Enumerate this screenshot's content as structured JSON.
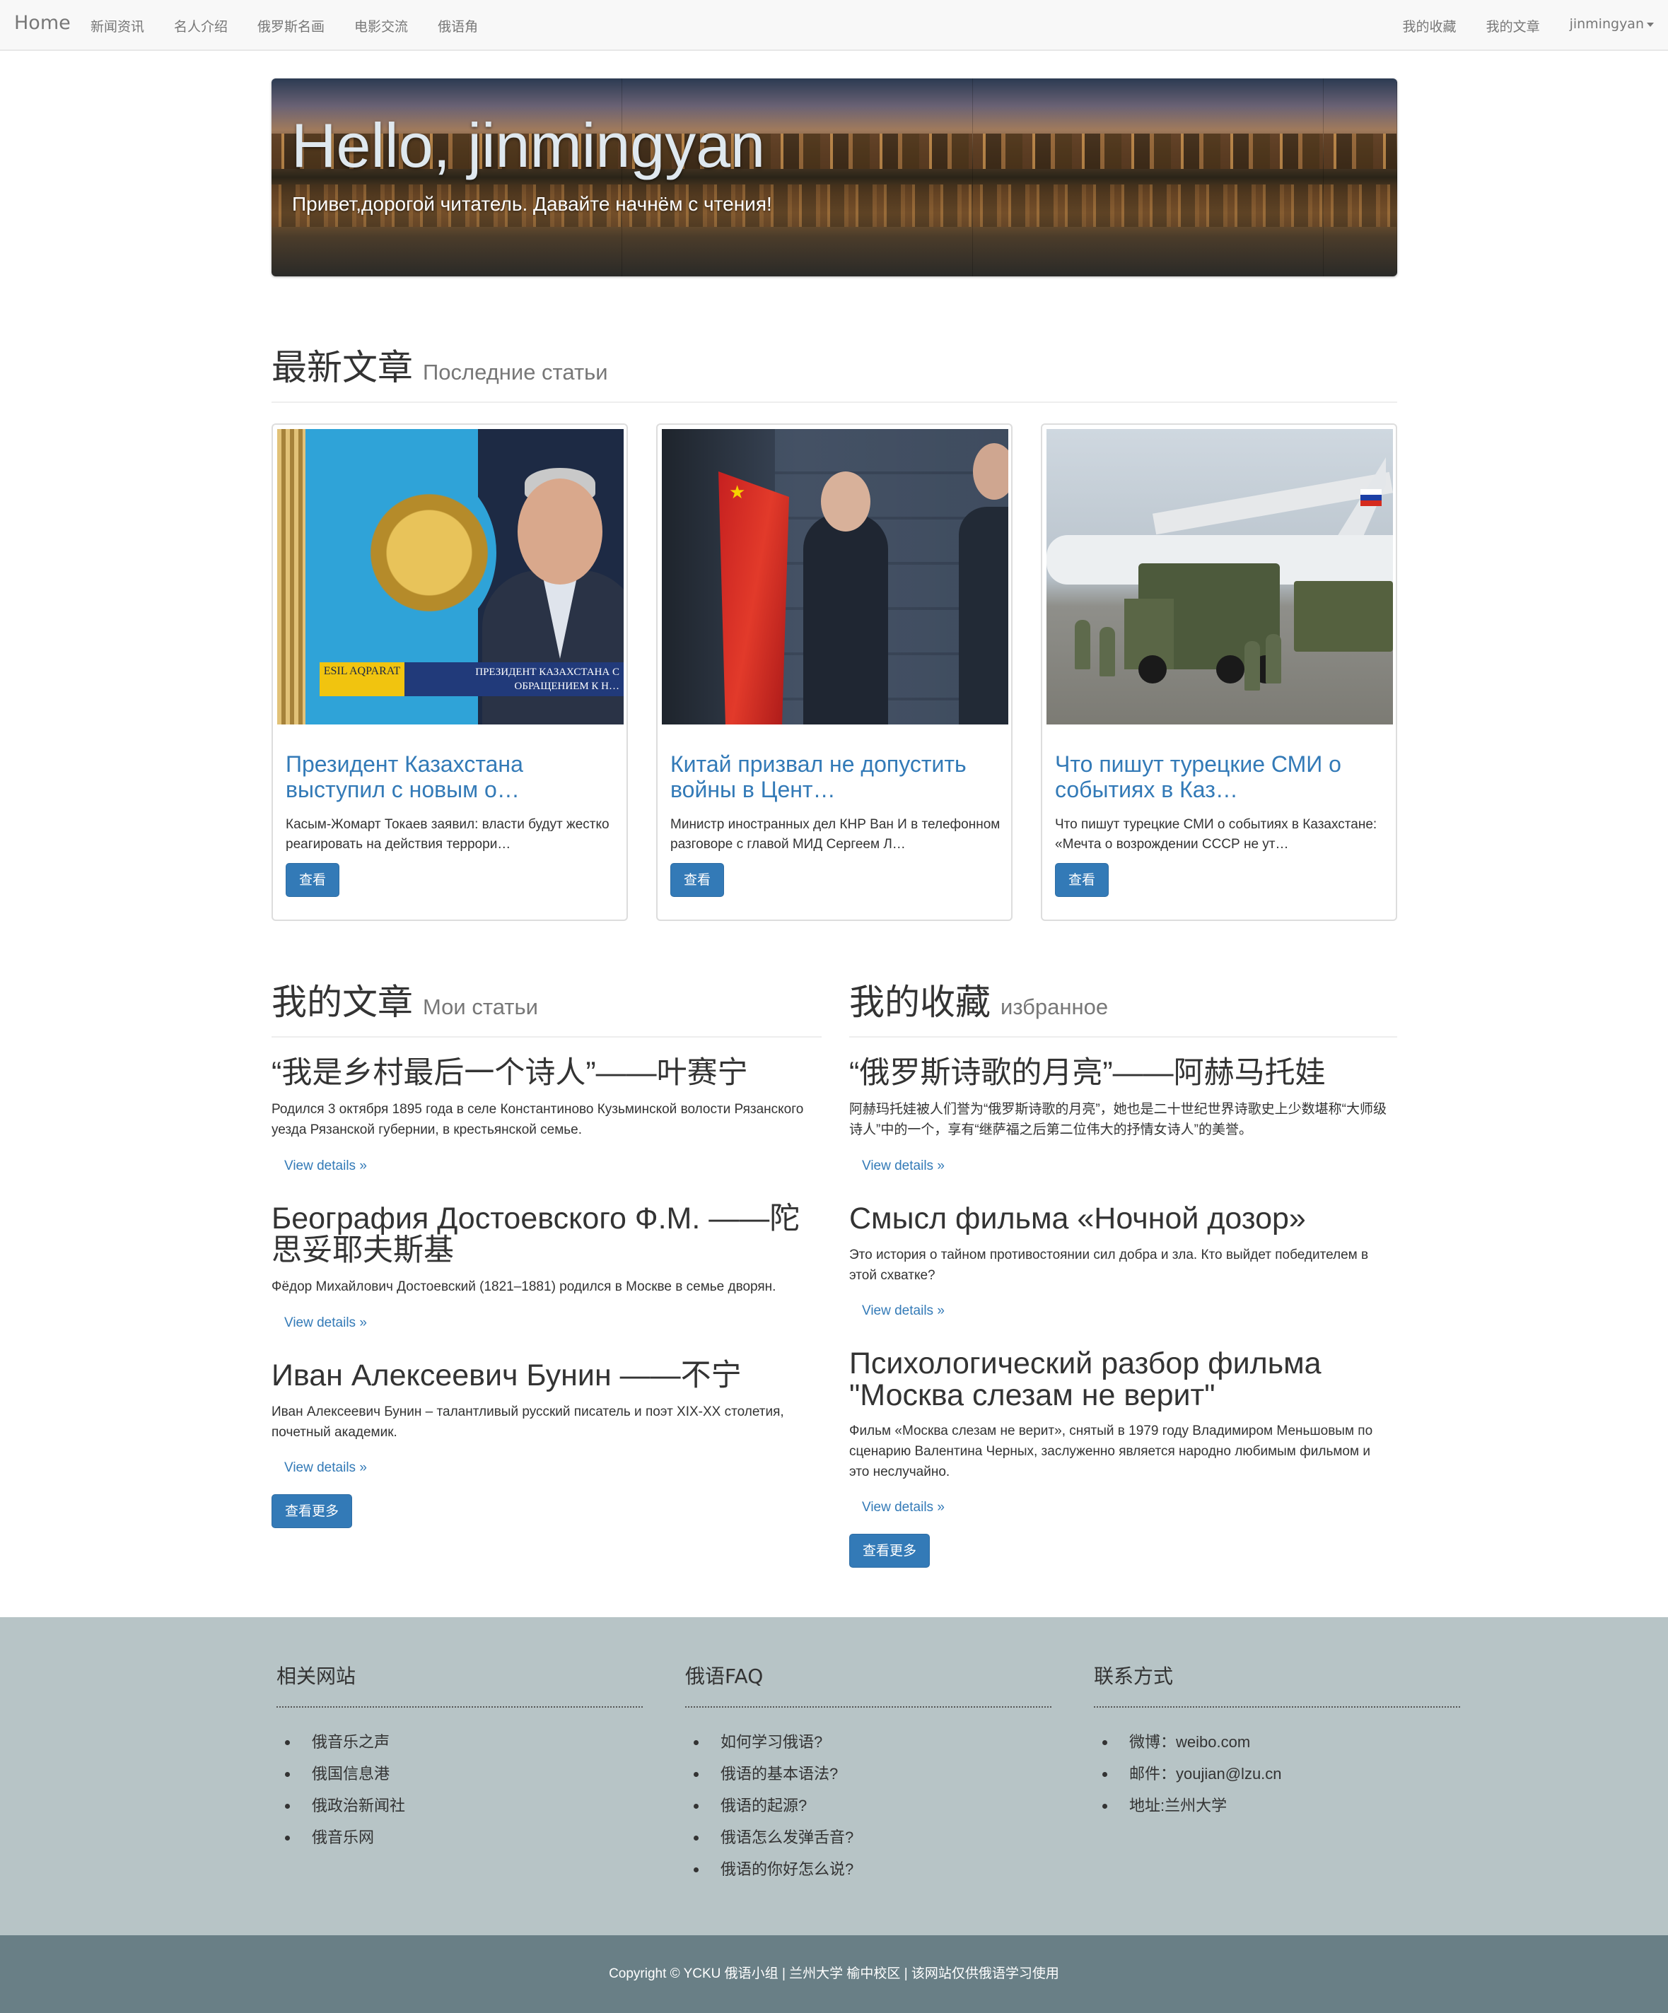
{
  "navbar": {
    "brand": "Home",
    "left_items": [
      "新闻资讯",
      "名人介绍",
      "俄罗斯名画",
      "电影交流",
      "俄语角"
    ],
    "right_items": [
      "我的收藏",
      "我的文章"
    ],
    "user": "jinmingyan"
  },
  "hero": {
    "title": "Hello, jinmingyan",
    "subtitle": "Привет,дорогой читатель. Давайте начнём с чтения!"
  },
  "latest": {
    "heading": "最新文章",
    "subheading": "Последние статьи",
    "cards": [
      {
        "title": "Президент Казахстана выступил с новым о…",
        "desc": "Касым-Жомарт Токаев заявил: власти будут жестко реагировать на действия террори…",
        "button": "查看",
        "ticker_left": "ESIL AQPARAT",
        "ticker_right": "ПРЕЗИДЕНТ КАЗАХСТАНА С ОБРАЩЕНИЕМ К Н…"
      },
      {
        "title": "Китай призвал не допустить войны в Цент…",
        "desc": "Министр иностранных дел КНР Ван И в телефонном разговоре с главой МИД Сергеем Л…",
        "button": "查看"
      },
      {
        "title": "Что пишут турецкие СМИ о событиях в Каз…",
        "desc": "Что пишут турецкие СМИ о событиях в Казахстане: «Мечта о возрождении СССР не ут…",
        "button": "查看"
      }
    ]
  },
  "my_articles": {
    "heading": "我的文章",
    "subheading": "Мои статьи",
    "items": [
      {
        "title": "“我是乡村最后一个诗人”——叶赛宁",
        "desc": "Родился 3 октября 1895 года в селе Константиново Кузьминской волости Рязанского уезда Рязанской губернии, в крестьянской семье.",
        "link": "View details »"
      },
      {
        "title": "Беография Достоевского Ф.М. ——陀思妥耶夫斯基",
        "desc": "Фёдор Михайлович Достоевский (1821–1881) родился в Москве в семье дворян.",
        "link": "View details »"
      },
      {
        "title": "Иван Алексеевич Бунин ——不宁",
        "desc": "Иван Алексеевич Бунин – талантливый русский писатель и поэт XIX-XX столетия, почетный академик.",
        "link": "View details »"
      }
    ],
    "more_button": "查看更多"
  },
  "favorites": {
    "heading": "我的收藏",
    "subheading": "избранное",
    "items": [
      {
        "title": "“俄罗斯诗歌的月亮”——阿赫马托娃",
        "desc": "阿赫玛托娃被人们誉为“俄罗斯诗歌的月亮”，她也是二十世纪世界诗歌史上少数堪称“大师级诗人”中的一个，享有“继萨福之后第二位伟大的抒情女诗人”的美誉。",
        "link": "View details »"
      },
      {
        "title": "Смысл фильма «Ночной дозор»",
        "desc": "Это история о тайном противостоянии сил добра и зла. Кто выйдет победителем в этой схватке?",
        "link": "View details »"
      },
      {
        "title": "Психологический разбор фильма \"Москва слезам не верит\"",
        "desc": "Фильм «Москва слезам не верит», снятый в 1979 году Владимиром Меньшовым по сценарию Валентина Черных, заслуженно является народно любимым фильмом и это неслучайно.",
        "link": "View details »"
      }
    ],
    "more_button": "查看更多"
  },
  "footer": {
    "columns": [
      {
        "heading": "相关网站",
        "items": [
          "俄音乐之声",
          "俄国信息港",
          "俄政治新闻社",
          "俄音乐网"
        ]
      },
      {
        "heading": "俄语FAQ",
        "items": [
          "如何学习俄语?",
          "俄语的基本语法?",
          "俄语的起源?",
          "俄语怎么发弹舌音?",
          "俄语的你好怎么说?"
        ]
      },
      {
        "heading": "联系方式",
        "items": [
          "微博：weibo.com",
          "邮件：youjian@lzu.cn",
          "地址:兰州大学"
        ]
      }
    ],
    "copyright": "Copyright © YCKU 俄语小组 | 兰州大学 榆中校区 | 该网站仅供俄语学习使用"
  },
  "colors": {
    "link": "#337ab7",
    "button": "#337ab7",
    "footer_bg": "#b7c4c6",
    "copyright_bg": "#697f86",
    "navbar_bg": "#f8f8f8"
  }
}
